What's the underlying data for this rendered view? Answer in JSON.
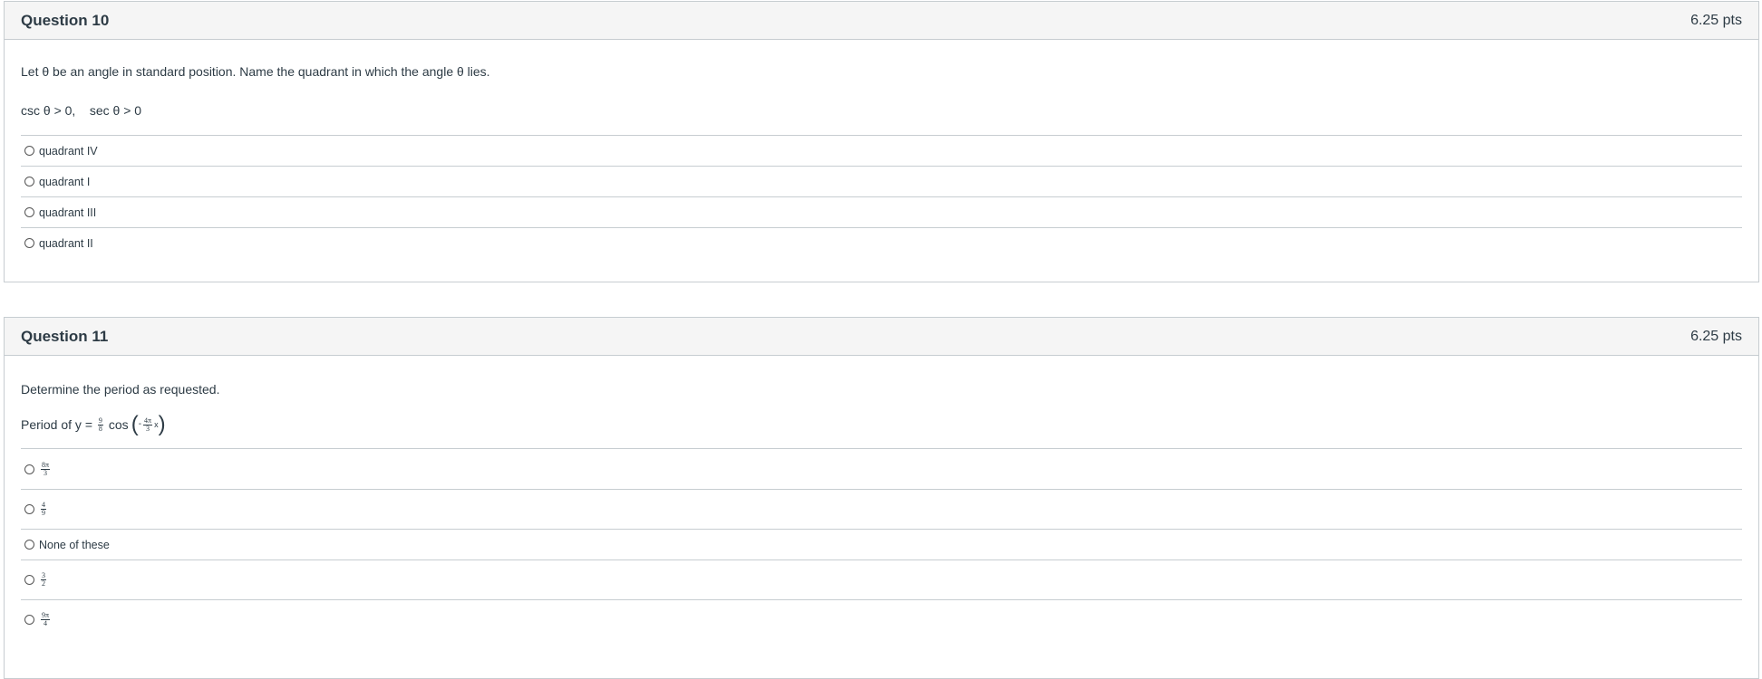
{
  "q10": {
    "title": "Question 10",
    "points": "6.25 pts",
    "prompt": "Let θ be an angle in standard position. Name the quadrant in which the angle θ lies.",
    "condition": "csc θ > 0,    sec θ > 0",
    "answers": [
      "quadrant IV",
      "quadrant I",
      "quadrant III",
      "quadrant II"
    ]
  },
  "q11": {
    "title": "Question 11",
    "points": "6.25 pts",
    "prompt": "Determine the period as requested.",
    "formula": {
      "prefix": "Period of y = ",
      "coef_num": "9",
      "coef_den": "8",
      "func": "cos",
      "arg_num": "4π",
      "arg_den": "3",
      "arg_sign": "-",
      "var": "x"
    },
    "answers": [
      {
        "num": "8π",
        "den": "3"
      },
      {
        "num": "4",
        "den": "9"
      },
      {
        "text": "None of these"
      },
      {
        "num": "3",
        "den": "2"
      },
      {
        "num": "9π",
        "den": "4"
      }
    ]
  }
}
